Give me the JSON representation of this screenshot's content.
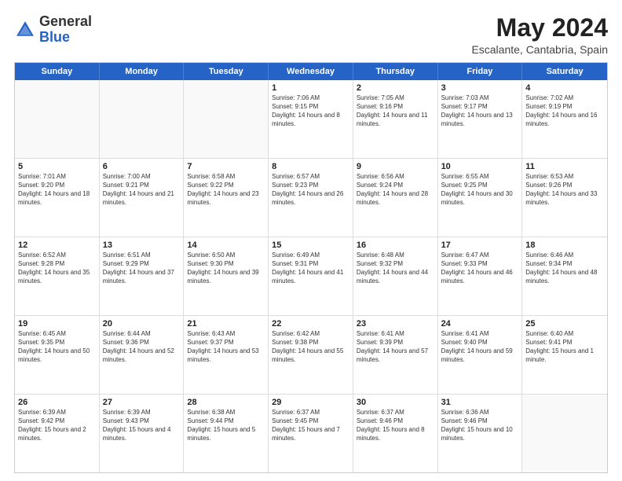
{
  "header": {
    "logo": {
      "general": "General",
      "blue": "Blue"
    },
    "title": "May 2024",
    "location": "Escalante, Cantabria, Spain"
  },
  "calendar": {
    "days_of_week": [
      "Sunday",
      "Monday",
      "Tuesday",
      "Wednesday",
      "Thursday",
      "Friday",
      "Saturday"
    ],
    "weeks": [
      [
        {
          "day": "",
          "empty": true
        },
        {
          "day": "",
          "empty": true
        },
        {
          "day": "",
          "empty": true
        },
        {
          "day": "1",
          "sunrise": "Sunrise: 7:06 AM",
          "sunset": "Sunset: 9:15 PM",
          "daylight": "Daylight: 14 hours and 8 minutes."
        },
        {
          "day": "2",
          "sunrise": "Sunrise: 7:05 AM",
          "sunset": "Sunset: 9:16 PM",
          "daylight": "Daylight: 14 hours and 11 minutes."
        },
        {
          "day": "3",
          "sunrise": "Sunrise: 7:03 AM",
          "sunset": "Sunset: 9:17 PM",
          "daylight": "Daylight: 14 hours and 13 minutes."
        },
        {
          "day": "4",
          "sunrise": "Sunrise: 7:02 AM",
          "sunset": "Sunset: 9:19 PM",
          "daylight": "Daylight: 14 hours and 16 minutes."
        }
      ],
      [
        {
          "day": "5",
          "sunrise": "Sunrise: 7:01 AM",
          "sunset": "Sunset: 9:20 PM",
          "daylight": "Daylight: 14 hours and 18 minutes."
        },
        {
          "day": "6",
          "sunrise": "Sunrise: 7:00 AM",
          "sunset": "Sunset: 9:21 PM",
          "daylight": "Daylight: 14 hours and 21 minutes."
        },
        {
          "day": "7",
          "sunrise": "Sunrise: 6:58 AM",
          "sunset": "Sunset: 9:22 PM",
          "daylight": "Daylight: 14 hours and 23 minutes."
        },
        {
          "day": "8",
          "sunrise": "Sunrise: 6:57 AM",
          "sunset": "Sunset: 9:23 PM",
          "daylight": "Daylight: 14 hours and 26 minutes."
        },
        {
          "day": "9",
          "sunrise": "Sunrise: 6:56 AM",
          "sunset": "Sunset: 9:24 PM",
          "daylight": "Daylight: 14 hours and 28 minutes."
        },
        {
          "day": "10",
          "sunrise": "Sunrise: 6:55 AM",
          "sunset": "Sunset: 9:25 PM",
          "daylight": "Daylight: 14 hours and 30 minutes."
        },
        {
          "day": "11",
          "sunrise": "Sunrise: 6:53 AM",
          "sunset": "Sunset: 9:26 PM",
          "daylight": "Daylight: 14 hours and 33 minutes."
        }
      ],
      [
        {
          "day": "12",
          "sunrise": "Sunrise: 6:52 AM",
          "sunset": "Sunset: 9:28 PM",
          "daylight": "Daylight: 14 hours and 35 minutes."
        },
        {
          "day": "13",
          "sunrise": "Sunrise: 6:51 AM",
          "sunset": "Sunset: 9:29 PM",
          "daylight": "Daylight: 14 hours and 37 minutes."
        },
        {
          "day": "14",
          "sunrise": "Sunrise: 6:50 AM",
          "sunset": "Sunset: 9:30 PM",
          "daylight": "Daylight: 14 hours and 39 minutes."
        },
        {
          "day": "15",
          "sunrise": "Sunrise: 6:49 AM",
          "sunset": "Sunset: 9:31 PM",
          "daylight": "Daylight: 14 hours and 41 minutes."
        },
        {
          "day": "16",
          "sunrise": "Sunrise: 6:48 AM",
          "sunset": "Sunset: 9:32 PM",
          "daylight": "Daylight: 14 hours and 44 minutes."
        },
        {
          "day": "17",
          "sunrise": "Sunrise: 6:47 AM",
          "sunset": "Sunset: 9:33 PM",
          "daylight": "Daylight: 14 hours and 46 minutes."
        },
        {
          "day": "18",
          "sunrise": "Sunrise: 6:46 AM",
          "sunset": "Sunset: 9:34 PM",
          "daylight": "Daylight: 14 hours and 48 minutes."
        }
      ],
      [
        {
          "day": "19",
          "sunrise": "Sunrise: 6:45 AM",
          "sunset": "Sunset: 9:35 PM",
          "daylight": "Daylight: 14 hours and 50 minutes."
        },
        {
          "day": "20",
          "sunrise": "Sunrise: 6:44 AM",
          "sunset": "Sunset: 9:36 PM",
          "daylight": "Daylight: 14 hours and 52 minutes."
        },
        {
          "day": "21",
          "sunrise": "Sunrise: 6:43 AM",
          "sunset": "Sunset: 9:37 PM",
          "daylight": "Daylight: 14 hours and 53 minutes."
        },
        {
          "day": "22",
          "sunrise": "Sunrise: 6:42 AM",
          "sunset": "Sunset: 9:38 PM",
          "daylight": "Daylight: 14 hours and 55 minutes."
        },
        {
          "day": "23",
          "sunrise": "Sunrise: 6:41 AM",
          "sunset": "Sunset: 9:39 PM",
          "daylight": "Daylight: 14 hours and 57 minutes."
        },
        {
          "day": "24",
          "sunrise": "Sunrise: 6:41 AM",
          "sunset": "Sunset: 9:40 PM",
          "daylight": "Daylight: 14 hours and 59 minutes."
        },
        {
          "day": "25",
          "sunrise": "Sunrise: 6:40 AM",
          "sunset": "Sunset: 9:41 PM",
          "daylight": "Daylight: 15 hours and 1 minute."
        }
      ],
      [
        {
          "day": "26",
          "sunrise": "Sunrise: 6:39 AM",
          "sunset": "Sunset: 9:42 PM",
          "daylight": "Daylight: 15 hours and 2 minutes."
        },
        {
          "day": "27",
          "sunrise": "Sunrise: 6:39 AM",
          "sunset": "Sunset: 9:43 PM",
          "daylight": "Daylight: 15 hours and 4 minutes."
        },
        {
          "day": "28",
          "sunrise": "Sunrise: 6:38 AM",
          "sunset": "Sunset: 9:44 PM",
          "daylight": "Daylight: 15 hours and 5 minutes."
        },
        {
          "day": "29",
          "sunrise": "Sunrise: 6:37 AM",
          "sunset": "Sunset: 9:45 PM",
          "daylight": "Daylight: 15 hours and 7 minutes."
        },
        {
          "day": "30",
          "sunrise": "Sunrise: 6:37 AM",
          "sunset": "Sunset: 9:46 PM",
          "daylight": "Daylight: 15 hours and 8 minutes."
        },
        {
          "day": "31",
          "sunrise": "Sunrise: 6:36 AM",
          "sunset": "Sunset: 9:46 PM",
          "daylight": "Daylight: 15 hours and 10 minutes."
        },
        {
          "day": "",
          "empty": true
        }
      ]
    ]
  }
}
